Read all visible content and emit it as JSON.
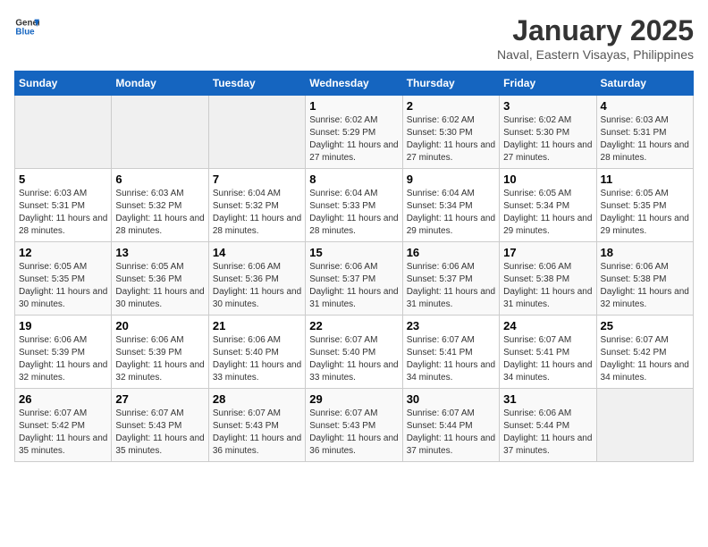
{
  "header": {
    "logo_general": "General",
    "logo_blue": "Blue",
    "title": "January 2025",
    "subtitle": "Naval, Eastern Visayas, Philippines"
  },
  "calendar": {
    "days_of_week": [
      "Sunday",
      "Monday",
      "Tuesday",
      "Wednesday",
      "Thursday",
      "Friday",
      "Saturday"
    ],
    "weeks": [
      [
        {
          "day": "",
          "info": ""
        },
        {
          "day": "",
          "info": ""
        },
        {
          "day": "",
          "info": ""
        },
        {
          "day": "1",
          "info": "Sunrise: 6:02 AM\nSunset: 5:29 PM\nDaylight: 11 hours and 27 minutes."
        },
        {
          "day": "2",
          "info": "Sunrise: 6:02 AM\nSunset: 5:30 PM\nDaylight: 11 hours and 27 minutes."
        },
        {
          "day": "3",
          "info": "Sunrise: 6:02 AM\nSunset: 5:30 PM\nDaylight: 11 hours and 27 minutes."
        },
        {
          "day": "4",
          "info": "Sunrise: 6:03 AM\nSunset: 5:31 PM\nDaylight: 11 hours and 28 minutes."
        }
      ],
      [
        {
          "day": "5",
          "info": "Sunrise: 6:03 AM\nSunset: 5:31 PM\nDaylight: 11 hours and 28 minutes."
        },
        {
          "day": "6",
          "info": "Sunrise: 6:03 AM\nSunset: 5:32 PM\nDaylight: 11 hours and 28 minutes."
        },
        {
          "day": "7",
          "info": "Sunrise: 6:04 AM\nSunset: 5:32 PM\nDaylight: 11 hours and 28 minutes."
        },
        {
          "day": "8",
          "info": "Sunrise: 6:04 AM\nSunset: 5:33 PM\nDaylight: 11 hours and 28 minutes."
        },
        {
          "day": "9",
          "info": "Sunrise: 6:04 AM\nSunset: 5:34 PM\nDaylight: 11 hours and 29 minutes."
        },
        {
          "day": "10",
          "info": "Sunrise: 6:05 AM\nSunset: 5:34 PM\nDaylight: 11 hours and 29 minutes."
        },
        {
          "day": "11",
          "info": "Sunrise: 6:05 AM\nSunset: 5:35 PM\nDaylight: 11 hours and 29 minutes."
        }
      ],
      [
        {
          "day": "12",
          "info": "Sunrise: 6:05 AM\nSunset: 5:35 PM\nDaylight: 11 hours and 30 minutes."
        },
        {
          "day": "13",
          "info": "Sunrise: 6:05 AM\nSunset: 5:36 PM\nDaylight: 11 hours and 30 minutes."
        },
        {
          "day": "14",
          "info": "Sunrise: 6:06 AM\nSunset: 5:36 PM\nDaylight: 11 hours and 30 minutes."
        },
        {
          "day": "15",
          "info": "Sunrise: 6:06 AM\nSunset: 5:37 PM\nDaylight: 11 hours and 31 minutes."
        },
        {
          "day": "16",
          "info": "Sunrise: 6:06 AM\nSunset: 5:37 PM\nDaylight: 11 hours and 31 minutes."
        },
        {
          "day": "17",
          "info": "Sunrise: 6:06 AM\nSunset: 5:38 PM\nDaylight: 11 hours and 31 minutes."
        },
        {
          "day": "18",
          "info": "Sunrise: 6:06 AM\nSunset: 5:38 PM\nDaylight: 11 hours and 32 minutes."
        }
      ],
      [
        {
          "day": "19",
          "info": "Sunrise: 6:06 AM\nSunset: 5:39 PM\nDaylight: 11 hours and 32 minutes."
        },
        {
          "day": "20",
          "info": "Sunrise: 6:06 AM\nSunset: 5:39 PM\nDaylight: 11 hours and 32 minutes."
        },
        {
          "day": "21",
          "info": "Sunrise: 6:06 AM\nSunset: 5:40 PM\nDaylight: 11 hours and 33 minutes."
        },
        {
          "day": "22",
          "info": "Sunrise: 6:07 AM\nSunset: 5:40 PM\nDaylight: 11 hours and 33 minutes."
        },
        {
          "day": "23",
          "info": "Sunrise: 6:07 AM\nSunset: 5:41 PM\nDaylight: 11 hours and 34 minutes."
        },
        {
          "day": "24",
          "info": "Sunrise: 6:07 AM\nSunset: 5:41 PM\nDaylight: 11 hours and 34 minutes."
        },
        {
          "day": "25",
          "info": "Sunrise: 6:07 AM\nSunset: 5:42 PM\nDaylight: 11 hours and 34 minutes."
        }
      ],
      [
        {
          "day": "26",
          "info": "Sunrise: 6:07 AM\nSunset: 5:42 PM\nDaylight: 11 hours and 35 minutes."
        },
        {
          "day": "27",
          "info": "Sunrise: 6:07 AM\nSunset: 5:43 PM\nDaylight: 11 hours and 35 minutes."
        },
        {
          "day": "28",
          "info": "Sunrise: 6:07 AM\nSunset: 5:43 PM\nDaylight: 11 hours and 36 minutes."
        },
        {
          "day": "29",
          "info": "Sunrise: 6:07 AM\nSunset: 5:43 PM\nDaylight: 11 hours and 36 minutes."
        },
        {
          "day": "30",
          "info": "Sunrise: 6:07 AM\nSunset: 5:44 PM\nDaylight: 11 hours and 37 minutes."
        },
        {
          "day": "31",
          "info": "Sunrise: 6:06 AM\nSunset: 5:44 PM\nDaylight: 11 hours and 37 minutes."
        },
        {
          "day": "",
          "info": ""
        }
      ]
    ]
  }
}
